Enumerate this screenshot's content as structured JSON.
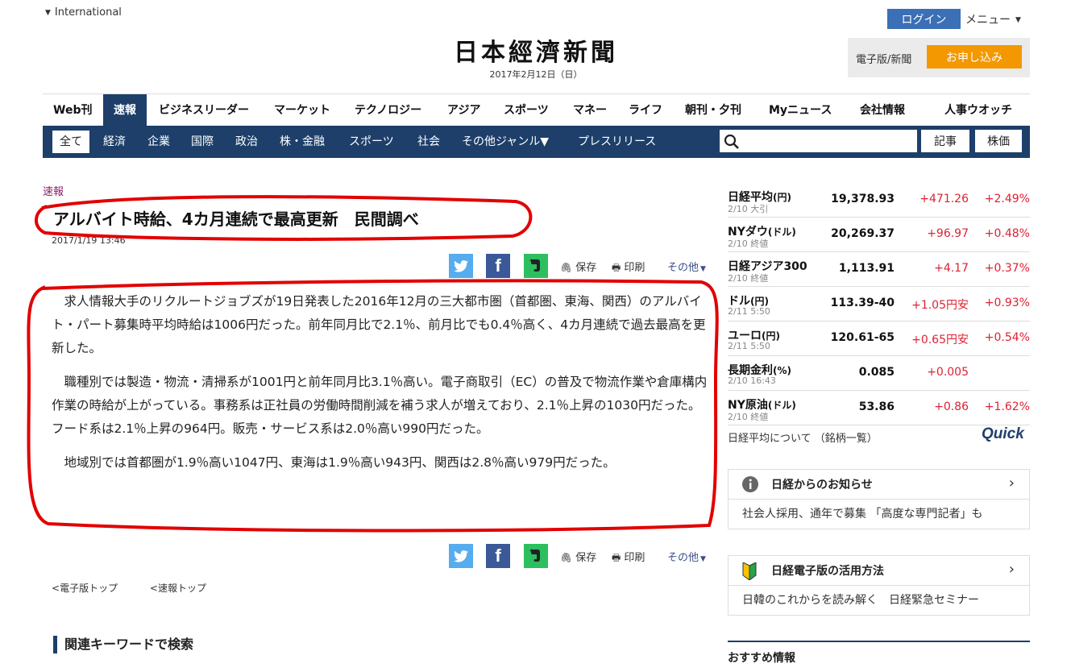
{
  "header": {
    "edition": "International",
    "logo": "日本經濟新聞",
    "date": "2017年2月12日（日）",
    "login": "ログイン",
    "menu": "メニュー",
    "subscribe_label": "電子版/新聞",
    "subscribe_button": "お申し込み"
  },
  "nav": {
    "primary": [
      "Web刊",
      "速報",
      "ビジネスリーダー",
      "マーケット",
      "テクノロジー",
      "アジア",
      "スポーツ",
      "マネー",
      "ライフ",
      "朝刊・夕刊",
      "Myニュース",
      "会社情報",
      "人事ウオッチ"
    ],
    "secondary": [
      "全て",
      "経済",
      "企業",
      "国際",
      "政治",
      "株・金融",
      "スポーツ",
      "社会",
      "その他ジャンル▼",
      "プレスリリース"
    ],
    "search_placeholder": "",
    "btn_article": "記事",
    "btn_stock": "株価"
  },
  "article": {
    "category": "速報",
    "title": "アルバイト時給、4カ月連続で最高更新　民間調べ",
    "date": "2017/1/19 13:46",
    "save": "保存",
    "print": "印刷",
    "more": "その他",
    "paragraphs": [
      "求人情報大手のリクルートジョブズが19日発表した2016年12月の三大都市圏（首都圏、東海、関西）のアルバイト・パート募集時平均時給は1006円だった。前年同月比で2.1％、前月比でも0.4％高く、4カ月連続で過去最高を更新した。",
      "職種別では製造・物流・清掃系が1001円と前年同月比3.1％高い。電子商取引（EC）の普及で物流作業や倉庫構内作業の時給が上がっている。事務系は正社員の労働時間削減を補う求人が増えており、2.1％上昇の1030円だった。フード系は2.1％上昇の964円。販売・サービス系は2.0％高い990円だった。",
      "地域別では首都圏が1.9％高い1047円、東海は1.9％高い943円、関西は2.8％高い979円だった。"
    ],
    "link_top": "電子版トップ",
    "link_sokuho": "速報トップ",
    "related": "関連キーワードで検索"
  },
  "market": {
    "rows": [
      {
        "name": "日経平均",
        "unit": "(円)",
        "when": "2/10 大引",
        "value": "19,378.93",
        "change": "+471.26",
        "pct": "+2.49%"
      },
      {
        "name": "NYダウ",
        "unit": "(ドル)",
        "when": "2/10 終値",
        "value": "20,269.37",
        "change": "+96.97",
        "pct": "+0.48%"
      },
      {
        "name": "日経アジア300",
        "unit": "",
        "when": "2/10 終値",
        "value": "1,113.91",
        "change": "+4.17",
        "pct": "+0.37%"
      },
      {
        "name": "ドル",
        "unit": "(円)",
        "when": "2/11 5:50",
        "value": "113.39-40",
        "change": "+1.05円安",
        "pct": "+0.93%"
      },
      {
        "name": "ユーロ",
        "unit": "(円)",
        "when": "2/11 5:50",
        "value": "120.61-65",
        "change": "+0.65円安",
        "pct": "+0.54%"
      },
      {
        "name": "長期金利",
        "unit": "(%)",
        "when": "2/10 16:43",
        "value": "0.085",
        "change": "+0.005",
        "pct": ""
      },
      {
        "name": "NY原油",
        "unit": "(ドル)",
        "when": "2/10 終値",
        "value": "53.86",
        "change": "+0.86",
        "pct": "+1.62%"
      }
    ],
    "footer": "日経平均について （銘柄一覧）",
    "brand": "Quick"
  },
  "notices": {
    "box1_title": "日経からのお知らせ",
    "box1_body": "社会人採用、通年で募集 「高度な専門記者」も",
    "box2_title": "日経電子版の活用方法",
    "box2_body": "日韓のこれからを読み解く　日経緊急セミナー",
    "osusume": "おすすめ情報"
  }
}
